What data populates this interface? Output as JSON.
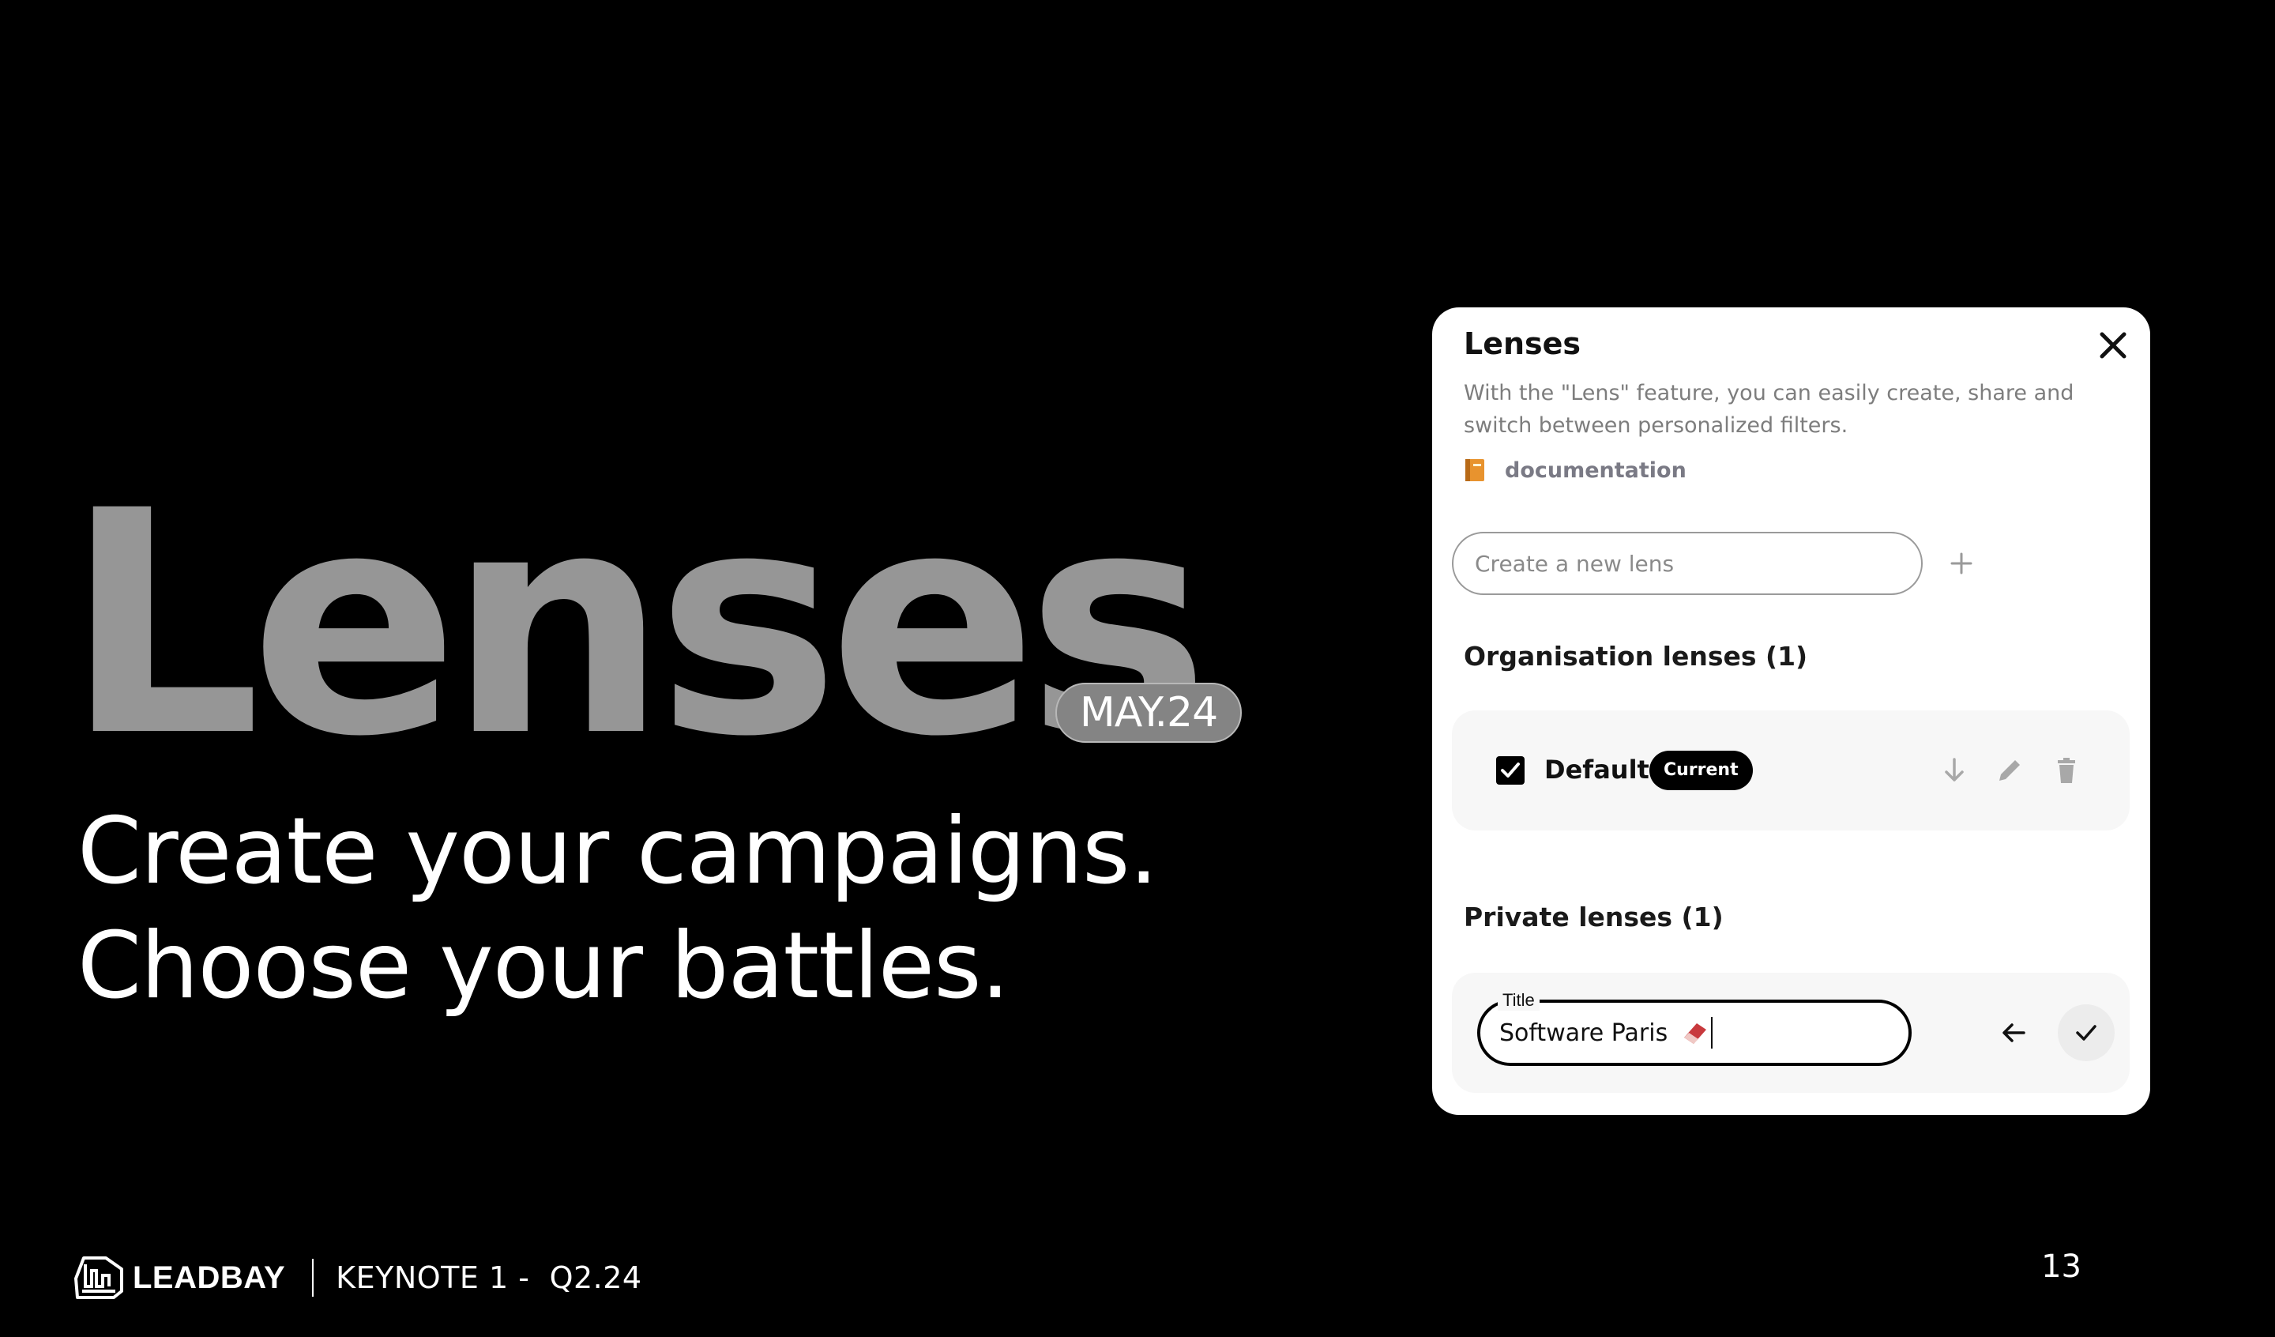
{
  "slide": {
    "title": "Lenses",
    "date_badge": "MAY.24",
    "tagline_line1": "Create your campaigns.",
    "tagline_line2": "Choose your battles.",
    "page_number": "13"
  },
  "footer": {
    "brand": "LEADBAY",
    "keynote": "KEYNOTE 1 -  Q2.24"
  },
  "modal": {
    "title": "Lenses",
    "description": "With the \"Lens\" feature, you can easily create, share and switch between personalized filters.",
    "doc_link": "documentation",
    "new_lens_placeholder": "Create a new lens",
    "org_section": "Organisation lenses (1)",
    "org_lens": {
      "name": "Default",
      "badge": "Current",
      "checked": true
    },
    "private_section": "Private lenses (1)",
    "private_lens_edit": {
      "field_label": "Title",
      "value": "Software Paris"
    }
  },
  "icons": [
    "close-icon",
    "book-icon",
    "plus-icon",
    "checkbox-checked-icon",
    "arrow-down-icon",
    "pencil-icon",
    "trash-icon",
    "eraser-icon",
    "arrow-left-icon",
    "check-icon",
    "leadbay-logo-icon"
  ],
  "colors": {
    "background": "#000000",
    "hero_title": "#969696",
    "badge_bg": "#848484",
    "modal_bg": "#ffffff",
    "card_bg": "#f7f7f7",
    "muted_text": "#7d7d7d",
    "current_badge": "#000000"
  }
}
